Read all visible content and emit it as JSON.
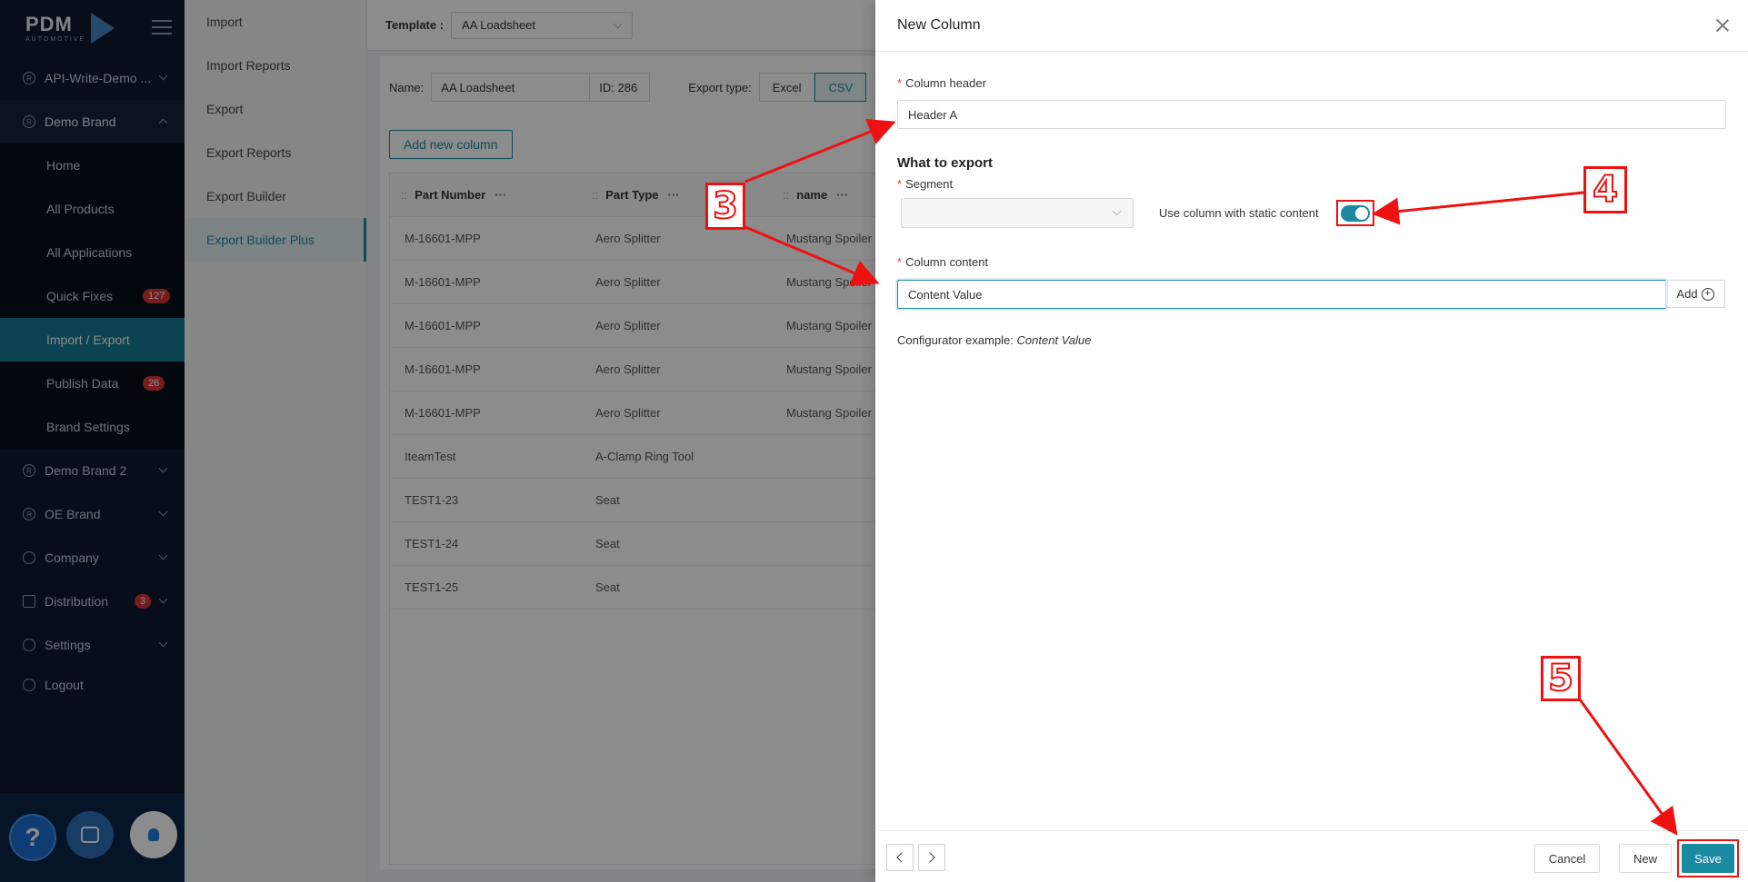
{
  "sidebar": {
    "logo": "PDM",
    "logo_sub": "AUTOMOTIVE",
    "groups": [
      {
        "label": "API-Write-Demo ...",
        "icon": "R"
      },
      {
        "label": "Demo Brand",
        "icon": "R"
      }
    ],
    "sub_items": [
      {
        "label": "Home"
      },
      {
        "label": "All Products"
      },
      {
        "label": "All Applications"
      },
      {
        "label": "Quick Fixes",
        "badge": "127"
      },
      {
        "label": "Import / Export"
      },
      {
        "label": "Publish Data",
        "badge": "26"
      },
      {
        "label": "Brand Settings"
      }
    ],
    "lower_groups": [
      {
        "label": "Demo Brand 2",
        "icon": "R"
      },
      {
        "label": "OE Brand",
        "icon": "R"
      },
      {
        "label": "Company",
        "icon": "globe"
      },
      {
        "label": "Distribution",
        "icon": "box",
        "badge": "3"
      },
      {
        "label": "Settings",
        "icon": "gear"
      },
      {
        "label": "Logout",
        "icon": "logout"
      }
    ],
    "help_label": "?"
  },
  "submenu": {
    "items": [
      "Import",
      "Import Reports",
      "Export",
      "Export Reports",
      "Export Builder",
      "Export Builder Plus"
    ]
  },
  "main": {
    "template_label": "Template :",
    "template_value": "AA Loadsheet",
    "name_label": "Name:",
    "name_value": "AA Loadsheet",
    "id_value": "ID: 286",
    "export_type_label": "Export type:",
    "export_types": [
      "Excel",
      "CSV"
    ],
    "add_column_label": "Add new column",
    "columns": [
      "Part Number",
      "Part Type",
      "name"
    ],
    "rows": [
      [
        "M-16601-MPP",
        "Aero Splitter",
        "Mustang Spoiler"
      ],
      [
        "M-16601-MPP",
        "Aero Splitter",
        "Mustang Spoiler"
      ],
      [
        "M-16601-MPP",
        "Aero Splitter",
        "Mustang Spoiler"
      ],
      [
        "M-16601-MPP",
        "Aero Splitter",
        "Mustang Spoiler"
      ],
      [
        "M-16601-MPP",
        "Aero Splitter",
        "Mustang Spoiler"
      ],
      [
        "IteamTest",
        "A-Clamp Ring Tool",
        ""
      ],
      [
        "TEST1-23",
        "Seat",
        ""
      ],
      [
        "TEST1-24",
        "Seat",
        ""
      ],
      [
        "TEST1-25",
        "Seat",
        ""
      ]
    ]
  },
  "drawer": {
    "title": "New Column",
    "column_header_label": "Column header",
    "column_header_value": "Header A",
    "what_to_export": "What to export",
    "segment_label": "Segment",
    "static_toggle_label": "Use column with static content",
    "column_content_label": "Column content",
    "column_content_value": "Content Value",
    "add_label": "Add",
    "example_prefix": "Configurator example:",
    "example_value": "Content Value",
    "cancel_label": "Cancel",
    "new_label": "New",
    "save_label": "Save"
  },
  "annotations": [
    "3",
    "4",
    "5"
  ],
  "colors": {
    "accent": "#1a8aa3",
    "sidebar_bg": "#0d1b2e",
    "annotation_red": "#e11"
  }
}
